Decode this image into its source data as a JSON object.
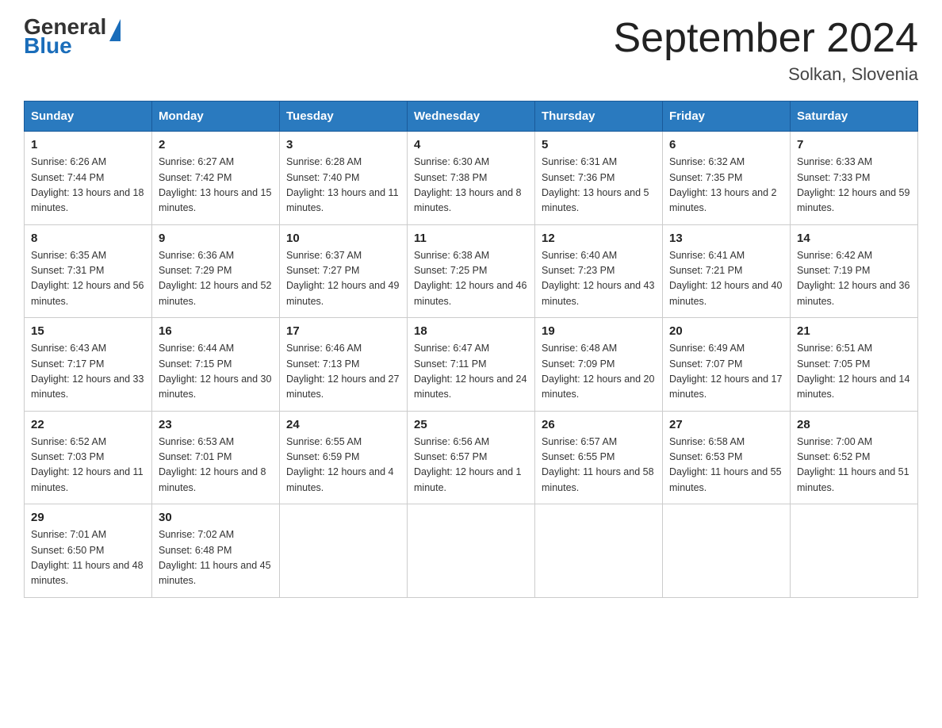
{
  "header": {
    "logo_general": "General",
    "logo_blue": "Blue",
    "month_title": "September 2024",
    "location": "Solkan, Slovenia"
  },
  "weekdays": [
    "Sunday",
    "Monday",
    "Tuesday",
    "Wednesday",
    "Thursday",
    "Friday",
    "Saturday"
  ],
  "weeks": [
    [
      {
        "day": "1",
        "sunrise": "6:26 AM",
        "sunset": "7:44 PM",
        "daylight": "13 hours and 18 minutes."
      },
      {
        "day": "2",
        "sunrise": "6:27 AM",
        "sunset": "7:42 PM",
        "daylight": "13 hours and 15 minutes."
      },
      {
        "day": "3",
        "sunrise": "6:28 AM",
        "sunset": "7:40 PM",
        "daylight": "13 hours and 11 minutes."
      },
      {
        "day": "4",
        "sunrise": "6:30 AM",
        "sunset": "7:38 PM",
        "daylight": "13 hours and 8 minutes."
      },
      {
        "day": "5",
        "sunrise": "6:31 AM",
        "sunset": "7:36 PM",
        "daylight": "13 hours and 5 minutes."
      },
      {
        "day": "6",
        "sunrise": "6:32 AM",
        "sunset": "7:35 PM",
        "daylight": "13 hours and 2 minutes."
      },
      {
        "day": "7",
        "sunrise": "6:33 AM",
        "sunset": "7:33 PM",
        "daylight": "12 hours and 59 minutes."
      }
    ],
    [
      {
        "day": "8",
        "sunrise": "6:35 AM",
        "sunset": "7:31 PM",
        "daylight": "12 hours and 56 minutes."
      },
      {
        "day": "9",
        "sunrise": "6:36 AM",
        "sunset": "7:29 PM",
        "daylight": "12 hours and 52 minutes."
      },
      {
        "day": "10",
        "sunrise": "6:37 AM",
        "sunset": "7:27 PM",
        "daylight": "12 hours and 49 minutes."
      },
      {
        "day": "11",
        "sunrise": "6:38 AM",
        "sunset": "7:25 PM",
        "daylight": "12 hours and 46 minutes."
      },
      {
        "day": "12",
        "sunrise": "6:40 AM",
        "sunset": "7:23 PM",
        "daylight": "12 hours and 43 minutes."
      },
      {
        "day": "13",
        "sunrise": "6:41 AM",
        "sunset": "7:21 PM",
        "daylight": "12 hours and 40 minutes."
      },
      {
        "day": "14",
        "sunrise": "6:42 AM",
        "sunset": "7:19 PM",
        "daylight": "12 hours and 36 minutes."
      }
    ],
    [
      {
        "day": "15",
        "sunrise": "6:43 AM",
        "sunset": "7:17 PM",
        "daylight": "12 hours and 33 minutes."
      },
      {
        "day": "16",
        "sunrise": "6:44 AM",
        "sunset": "7:15 PM",
        "daylight": "12 hours and 30 minutes."
      },
      {
        "day": "17",
        "sunrise": "6:46 AM",
        "sunset": "7:13 PM",
        "daylight": "12 hours and 27 minutes."
      },
      {
        "day": "18",
        "sunrise": "6:47 AM",
        "sunset": "7:11 PM",
        "daylight": "12 hours and 24 minutes."
      },
      {
        "day": "19",
        "sunrise": "6:48 AM",
        "sunset": "7:09 PM",
        "daylight": "12 hours and 20 minutes."
      },
      {
        "day": "20",
        "sunrise": "6:49 AM",
        "sunset": "7:07 PM",
        "daylight": "12 hours and 17 minutes."
      },
      {
        "day": "21",
        "sunrise": "6:51 AM",
        "sunset": "7:05 PM",
        "daylight": "12 hours and 14 minutes."
      }
    ],
    [
      {
        "day": "22",
        "sunrise": "6:52 AM",
        "sunset": "7:03 PM",
        "daylight": "12 hours and 11 minutes."
      },
      {
        "day": "23",
        "sunrise": "6:53 AM",
        "sunset": "7:01 PM",
        "daylight": "12 hours and 8 minutes."
      },
      {
        "day": "24",
        "sunrise": "6:55 AM",
        "sunset": "6:59 PM",
        "daylight": "12 hours and 4 minutes."
      },
      {
        "day": "25",
        "sunrise": "6:56 AM",
        "sunset": "6:57 PM",
        "daylight": "12 hours and 1 minute."
      },
      {
        "day": "26",
        "sunrise": "6:57 AM",
        "sunset": "6:55 PM",
        "daylight": "11 hours and 58 minutes."
      },
      {
        "day": "27",
        "sunrise": "6:58 AM",
        "sunset": "6:53 PM",
        "daylight": "11 hours and 55 minutes."
      },
      {
        "day": "28",
        "sunrise": "7:00 AM",
        "sunset": "6:52 PM",
        "daylight": "11 hours and 51 minutes."
      }
    ],
    [
      {
        "day": "29",
        "sunrise": "7:01 AM",
        "sunset": "6:50 PM",
        "daylight": "11 hours and 48 minutes."
      },
      {
        "day": "30",
        "sunrise": "7:02 AM",
        "sunset": "6:48 PM",
        "daylight": "11 hours and 45 minutes."
      },
      null,
      null,
      null,
      null,
      null
    ]
  ]
}
